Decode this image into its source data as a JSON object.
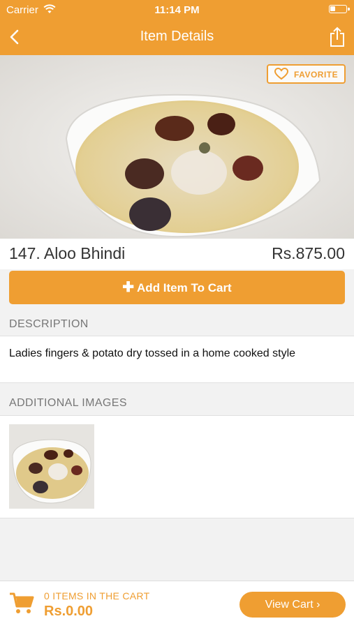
{
  "status_bar": {
    "carrier": "Carrier",
    "time": "11:14 PM"
  },
  "nav": {
    "title": "Item Details"
  },
  "hero": {
    "favorite_label": "FAVORITE"
  },
  "item": {
    "name": "147. Aloo Bhindi",
    "price": "Rs.875.00"
  },
  "actions": {
    "add_to_cart_label": "Add Item To Cart"
  },
  "description": {
    "header": "DESCRIPTION",
    "text": "Ladies fingers & potato dry tossed in a home cooked style"
  },
  "additional_images": {
    "header": "ADDITIONAL IMAGES"
  },
  "cart": {
    "count_label": "0 ITEMS IN THE CART",
    "total": "Rs.0.00",
    "view_cart_label": "View Cart ›"
  },
  "colors": {
    "accent": "#ef9e32",
    "background": "#f2f2f2"
  },
  "icons": [
    "back-chevron-icon",
    "share-icon",
    "heart-icon",
    "plus-icon",
    "cart-icon",
    "wifi-icon",
    "battery-icon"
  ]
}
